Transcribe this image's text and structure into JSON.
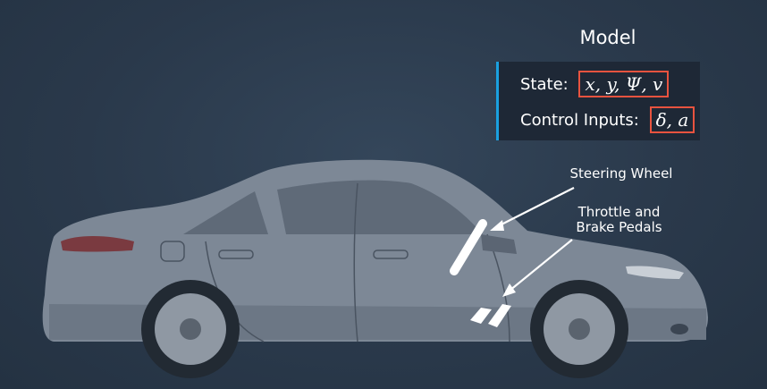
{
  "model": {
    "title": "Model",
    "state_label": "State:",
    "state_vars": "x, y, Ψ, v",
    "control_label": "Control Inputs:",
    "control_vars": "δ, a"
  },
  "annotations": {
    "steering_wheel": "Steering Wheel",
    "pedals_line1": "Throttle and",
    "pedals_line2": "Brake Pedals"
  },
  "colors": {
    "background": "#2b3a4c",
    "car_body": "#7d8896",
    "highlight_box": "#e8533f",
    "accent_bar": "#1aa0e0"
  }
}
